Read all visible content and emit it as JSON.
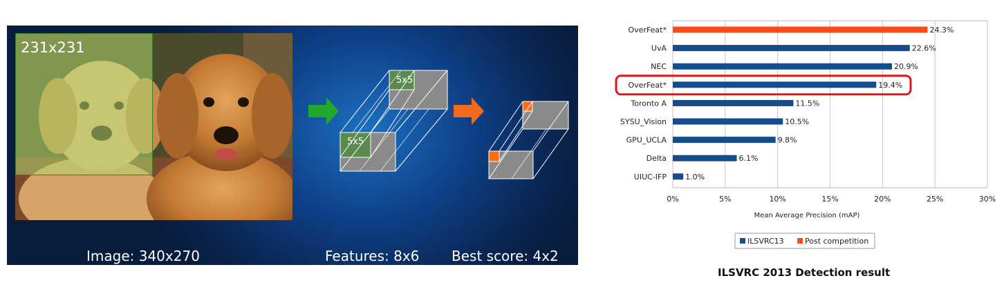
{
  "slide": {
    "crop_label": "231x231",
    "image_caption": "Image: 340x270",
    "features_caption": "Features: 8x6",
    "score_caption": "Best score: 4x2",
    "block_label_top": "5x5",
    "block_label_bottom": "5x5",
    "colors": {
      "green_arrow": "#22a82a",
      "orange_arrow": "#f26a1e",
      "block": "#8a8a8a",
      "feature_green": "#5a8a4e",
      "score_orange": "#ff6a14"
    }
  },
  "chart_data": {
    "type": "bar",
    "orientation": "horizontal",
    "title": "ILSVRC 2013 Detection result",
    "xlabel": "Mean Average Precision (mAP)",
    "ylabel": "",
    "xlim": [
      0,
      30
    ],
    "xticks": [
      "0%",
      "5%",
      "10%",
      "15%",
      "20%",
      "25%",
      "30%"
    ],
    "xtick_values": [
      0,
      5,
      10,
      15,
      20,
      25,
      30
    ],
    "grid": "vertical",
    "legend_position": "bottom",
    "categories": [
      "OverFeat*",
      "UvA",
      "NEC",
      "OverFeat*",
      "Toronto A",
      "SYSU_Vision",
      "GPU_UCLA",
      "Delta",
      "UIUC-IFP"
    ],
    "values": [
      24.3,
      22.6,
      20.9,
      19.4,
      11.5,
      10.5,
      9.8,
      6.1,
      1.0
    ],
    "value_labels": [
      "24.3%",
      "22.6%",
      "20.9%",
      "19.4%",
      "11.5%",
      "10.5%",
      "9.8%",
      "6.1%",
      "1.0%"
    ],
    "series_membership": [
      "Post competition",
      "ILSVRC13",
      "ILSVRC13",
      "ILSVRC13",
      "ILSVRC13",
      "ILSVRC13",
      "ILSVRC13",
      "ILSVRC13",
      "ILSVRC13"
    ],
    "highlighted_index": 3,
    "series": [
      {
        "name": "ILSVRC13",
        "color": "#144c8c"
      },
      {
        "name": "Post competition",
        "color": "#ff4a1a"
      }
    ],
    "highlight_color": "#e41414"
  }
}
